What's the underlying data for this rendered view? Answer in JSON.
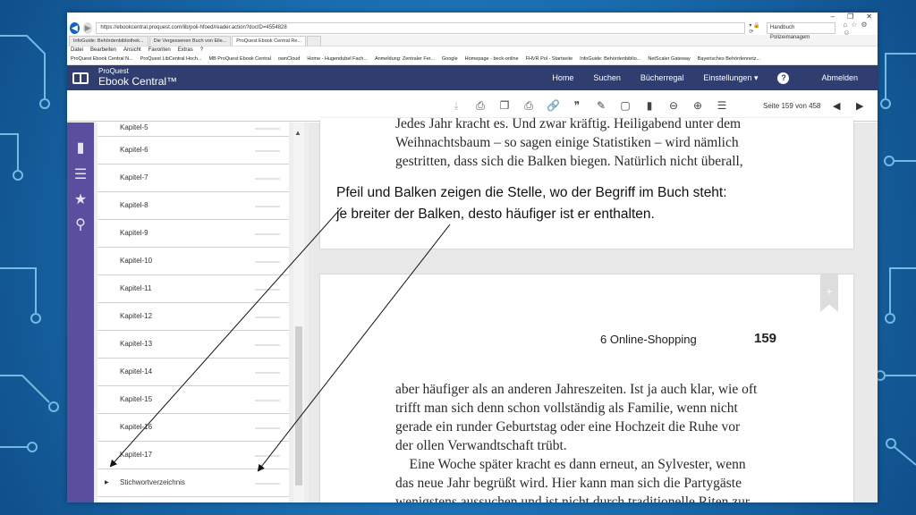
{
  "browser": {
    "url": "https://ebookcentral.proquest.com/lib/poli-hfoed/reader.action?docID=4554828",
    "search_value": "Handbuch Polizeimanagem",
    "tabs": [
      "InfoGuide: Behördenbibliothek...",
      "Die Vergessenen Buch von Elle...",
      "ProQuest Ebook Central Re...",
      ""
    ],
    "menu": [
      "Datei",
      "Bearbeiten",
      "Ansicht",
      "Favoriten",
      "Extras",
      "?"
    ],
    "favorites": [
      "ProQuest Ebook Central N...",
      "ProQuest LibCentral Hoch...",
      "MB ProQuest Ebook Central",
      "ownCloud",
      "Home - Hugendubel Fach...",
      "Anmeldung: Zentraler Fer...",
      "Google",
      "Homepage - beck-online",
      "FHVR Pol - Startseite",
      "InfoGuide: Behördenbiblio...",
      "NetScaler Gateway",
      "Bayerisches Behördennetz..."
    ]
  },
  "app": {
    "brand_top": "ProQuest",
    "brand_main": "Ebook Central™",
    "nav": {
      "home": "Home",
      "search": "Suchen",
      "shelf": "Bücherregal",
      "settings": "Einstellungen ▾",
      "logout": "Abmelden"
    },
    "page_info": "Seite 159 von 458"
  },
  "toc": [
    {
      "label": "Kapitel-5"
    },
    {
      "label": "Kapitel-6"
    },
    {
      "label": "Kapitel-7"
    },
    {
      "label": "Kapitel-8"
    },
    {
      "label": "Kapitel-9"
    },
    {
      "label": "Kapitel-10"
    },
    {
      "label": "Kapitel-11"
    },
    {
      "label": "Kapitel-12"
    },
    {
      "label": "Kapitel-13"
    },
    {
      "label": "Kapitel-14"
    },
    {
      "label": "Kapitel-15"
    },
    {
      "label": "Kapitel-16"
    },
    {
      "label": "Kapitel-17"
    },
    {
      "label": "Stichwortverzeichnis"
    }
  ],
  "page_top_lines": [
    "Jedes Jahr kracht es. Und zwar kräftig. Heiligabend unter dem",
    "Weihnachtsbaum – so sagen einige Statistiken – wird nämlich",
    "gestritten, dass sich die Balken biegen. Natürlich nicht überall,"
  ],
  "page_bottom": {
    "running_head": "6   Online-Shopping",
    "page_number": "159",
    "lines": [
      "aber häufiger als an anderen Jahreszeiten. Ist ja auch klar, wie oft",
      "trifft man sich denn schon vollständig als Familie, wenn nicht",
      "gerade ein runder Geburtstag oder eine Hochzeit die Ruhe vor",
      "der ollen Verwandtschaft trübt.",
      "    Eine Woche später kracht es dann erneut, an Sylvester, wenn",
      "das neue Jahr begrüßt wird. Hier kann man sich die Partygäste",
      "wenigstens aussuchen und ist nicht durch traditionelle Riten zur"
    ]
  },
  "annotation": {
    "line1": "Pfeil und Balken zeigen die Stelle, wo der Begriff im Buch steht:",
    "line2": "je breiter der Balken, desto häufiger ist er enthalten."
  }
}
